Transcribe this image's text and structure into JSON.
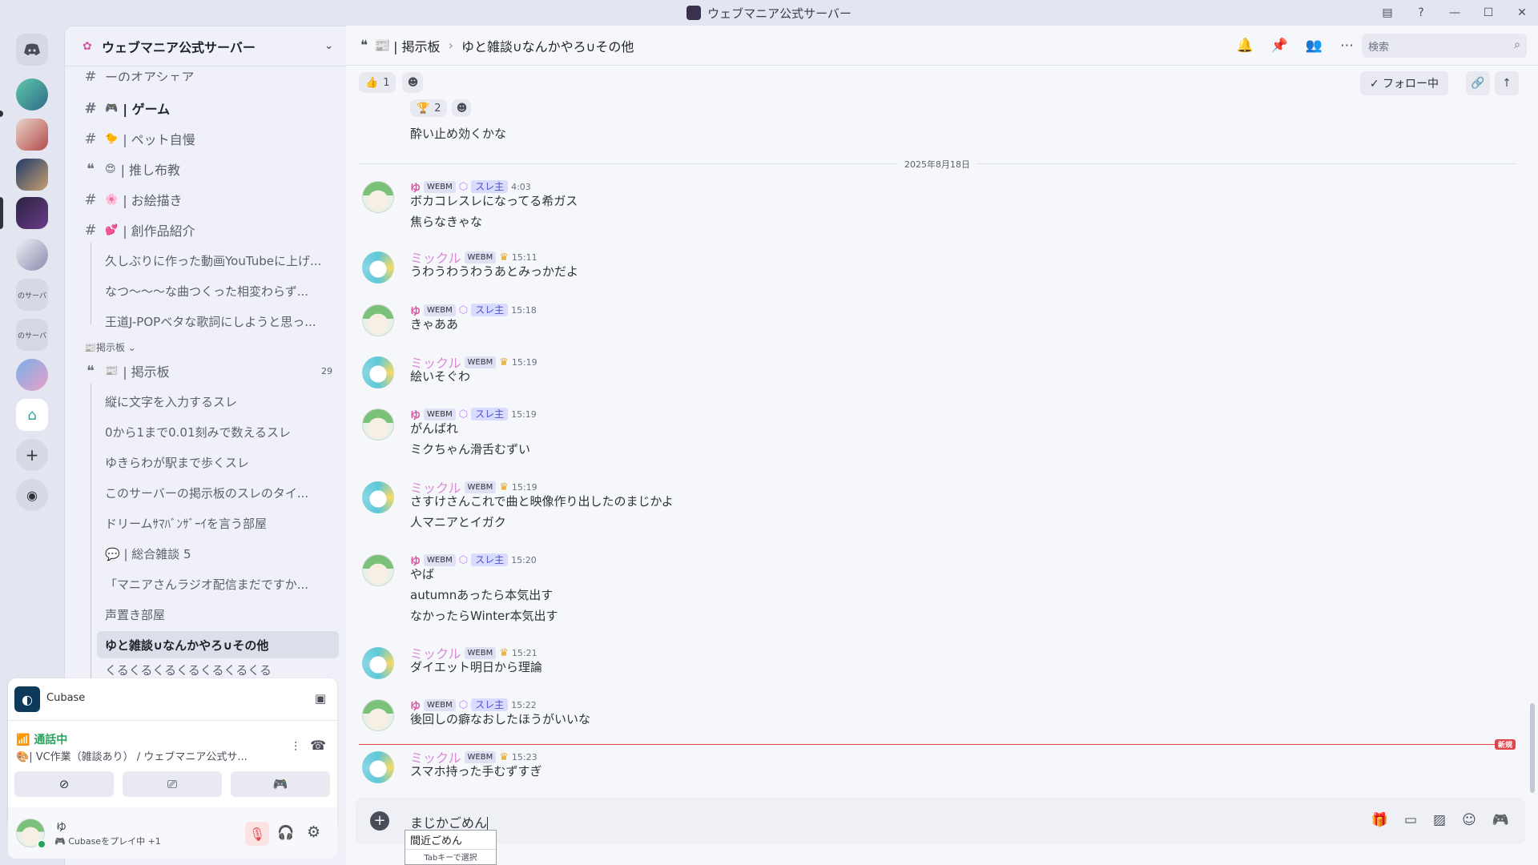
{
  "window": {
    "title": "ウェブマニア公式サーバー"
  },
  "rail": {
    "labels": [
      "のサーバ",
      "のサーバ"
    ]
  },
  "server": {
    "name": "ウェブマニア公式サーバー"
  },
  "channels": {
    "partial_top": "ーのオアシェア",
    "items": [
      {
        "emoji": "🎮",
        "label": "| ゲーム",
        "bold": true
      },
      {
        "emoji": "🐤",
        "label": "| ペット自慢"
      },
      {
        "emoji": "😍",
        "label": "| 推し布教"
      },
      {
        "emoji": "🌸",
        "label": "| お絵描き"
      },
      {
        "emoji": "💕",
        "label": "| 創作品紹介"
      }
    ],
    "threads_a": [
      "久しぶりに作った動画YouTubeに上げ...",
      "なつ〜〜〜な曲つくった相変わらず...",
      "王道J-POPベタな歌詞にしようと思っ..."
    ],
    "category": "📰掲示板 ⌄",
    "forum": {
      "label": "| 掲示板",
      "count": "29"
    },
    "threads_b": [
      "縦に文字を入力するスレ",
      "0から1まで0.01刻みで数えるスレ",
      "ゆきらわが駅まで歩くスレ",
      "このサーバーの掲示板のスレのタイ...",
      "ドリームｻﾏﾊﾞﾝｻﾞｰｲを言う部屋",
      "💬 | 総合雑談 5",
      "「マニアさんラジオ配信まだですか...",
      "声置き部屋",
      "ゆと雑談∪なんかやろ∪その他",
      "くるくるくるくるくるくるくる"
    ]
  },
  "activity": {
    "app": "Cubase"
  },
  "voice": {
    "status": "通話中",
    "channel": "| VC作業（雑談あり） / ウェブマニア公式サ..."
  },
  "user": {
    "name": "ゆ",
    "status": "Cubaseをプレイ中 +1"
  },
  "topbar": {
    "forum": "| 掲示板",
    "thread": "ゆと雑談∪なんかやろ∪その他",
    "search_placeholder": "検索"
  },
  "subbar": {
    "reaction_count": "1",
    "follow_label": "✓ フォロー中"
  },
  "prev": {
    "reaction_count": "2",
    "text": "酔い止め効くかな"
  },
  "date_divider": "2025年8月18日",
  "new_label": "新規",
  "messages": [
    {
      "author": "ゆ",
      "type": "yu",
      "time": "4:03",
      "lines": [
        "ボカコレスレになってる希ガス",
        "焦らなきゃな"
      ]
    },
    {
      "author": "ミックル",
      "type": "miku",
      "time": "15:11",
      "lines": [
        "うわうわうわうあとみっかだよ"
      ]
    },
    {
      "author": "ゆ",
      "type": "yu",
      "time": "15:18",
      "lines": [
        "きゃああ"
      ]
    },
    {
      "author": "ミックル",
      "type": "miku",
      "time": "15:19",
      "lines": [
        "絵いそぐわ"
      ]
    },
    {
      "author": "ゆ",
      "type": "yu",
      "time": "15:19",
      "lines": [
        "がんばれ",
        "ミクちゃん滑舌むずい"
      ]
    },
    {
      "author": "ミックル",
      "type": "miku",
      "time": "15:19",
      "lines": [
        "さすけさんこれで曲と映像作り出したのまじかよ",
        "人マニアとイガク"
      ]
    },
    {
      "author": "ゆ",
      "type": "yu",
      "time": "15:20",
      "lines": [
        "やば",
        "autumnあったら本気出す",
        "なかったらWinter本気出す"
      ]
    },
    {
      "author": "ミックル",
      "type": "miku",
      "time": "15:21",
      "lines": [
        "ダイエット明日から理論"
      ]
    },
    {
      "author": "ゆ",
      "type": "yu",
      "time": "15:22",
      "lines": [
        "後回しの癖なおしたほうがいいな"
      ]
    },
    {
      "author": "ミックル",
      "type": "miku",
      "time": "15:23",
      "lines": [
        "スマホ持った手むずすぎ"
      ]
    }
  ],
  "tag_label": "WEBM",
  "role_label": "スレ主",
  "composer": {
    "text": "まじかごめん",
    "ime_candidate": "間近ごめん",
    "ime_hint": "Tabキーで選択"
  },
  "colors": {
    "accent": "#5865f2",
    "new_line": "#e0454a",
    "yu_name": "#d4589f",
    "miku_name": "#d98bd5"
  }
}
